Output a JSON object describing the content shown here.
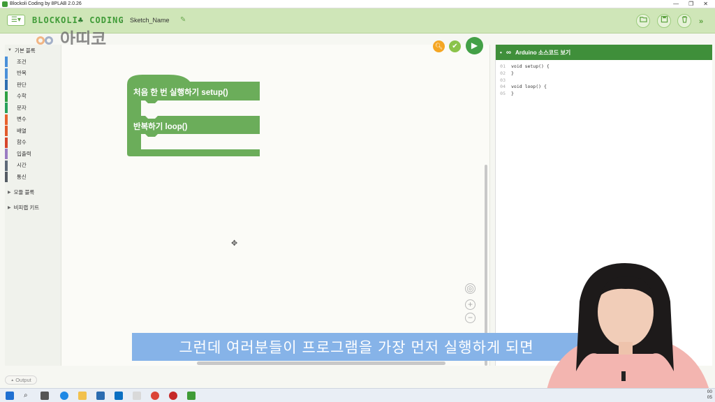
{
  "window": {
    "title": "Blockoli Coding by 8PLAB 2.0.26",
    "controls": [
      "—",
      "❐",
      "✕"
    ]
  },
  "header": {
    "logo_text": "BLOCKOLI",
    "logo_text2": "CODING",
    "separator": ":",
    "sketch_name": "Sketch_Name",
    "watermark": "아띠코",
    "buttons": [
      "open-folder-icon",
      "save-icon",
      "trash-icon"
    ],
    "more": "»"
  },
  "sidebar": {
    "basic_header": "기본 블록",
    "items": [
      {
        "label": "조건",
        "color": "#4a90d9"
      },
      {
        "label": "반복",
        "color": "#4a90d9"
      },
      {
        "label": "판단",
        "color": "#2e6fb0"
      },
      {
        "label": "수학",
        "color": "#2ea043"
      },
      {
        "label": "문자",
        "color": "#27a05a"
      },
      {
        "label": "변수",
        "color": "#e8622c"
      },
      {
        "label": "배열",
        "color": "#e25a2a"
      },
      {
        "label": "함수",
        "color": "#d6452b"
      },
      {
        "label": "입출력",
        "color": "#9b7cc2"
      },
      {
        "label": "시간",
        "color": "#5e6a78"
      },
      {
        "label": "통신",
        "color": "#555c64"
      }
    ],
    "module_header": "모듈 블록",
    "kit_header": "비피랩 키트"
  },
  "workspace": {
    "block_setup": "처음 한 번 실행하기 setup()",
    "block_loop": "반복하기 loop()",
    "block_color": "#6bad5a"
  },
  "code_panel": {
    "title": "Arduino 소스코드 보기",
    "bullet": "•",
    "lines": [
      {
        "n": "01",
        "code": "void setup() {"
      },
      {
        "n": "02",
        "code": "}"
      },
      {
        "n": "03",
        "code": ""
      },
      {
        "n": "04",
        "code": "void loop() {"
      },
      {
        "n": "05",
        "code": "}"
      }
    ]
  },
  "output": {
    "label": "Output",
    "arrow": "▲"
  },
  "subtitle": "그런데 여러분들이 프로그램을 가장 먼저 실행하게 되면",
  "taskbar": {
    "clock_line1": "00",
    "clock_line2": "05"
  }
}
